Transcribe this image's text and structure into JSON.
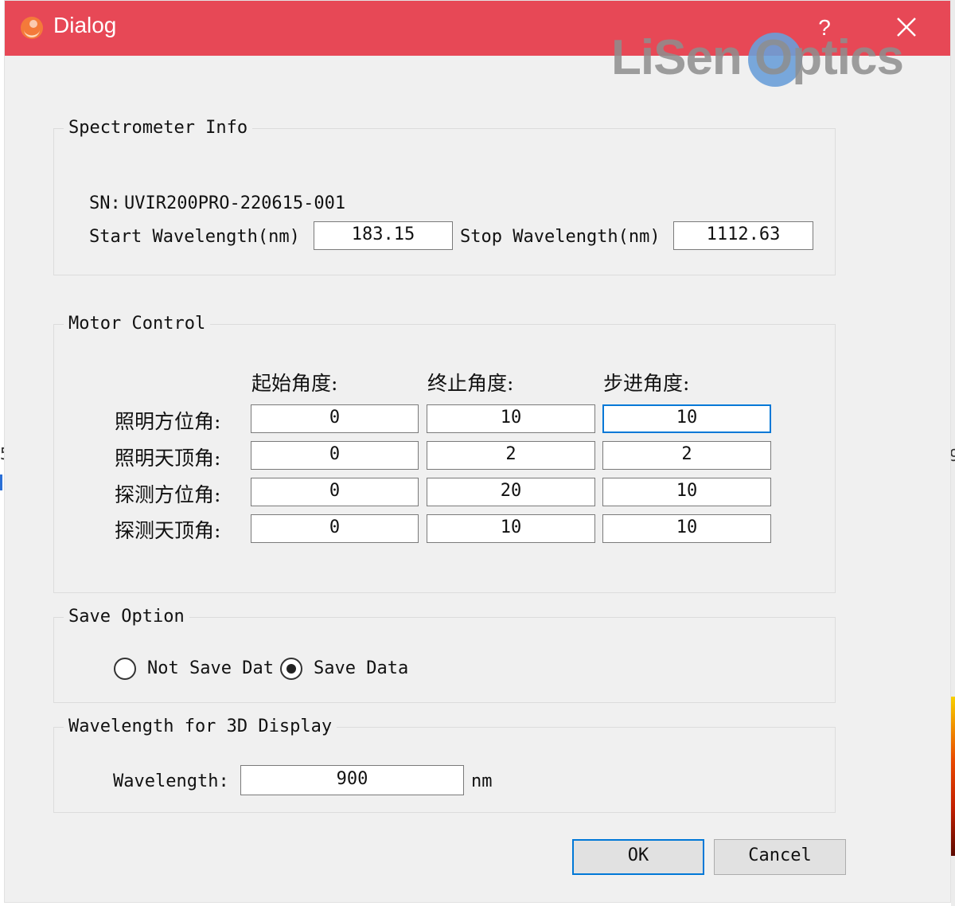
{
  "window": {
    "title": "Dialog",
    "help_label": "?",
    "icon": "app-logo-icon",
    "close_icon": "close-icon",
    "accent_color": "#e74856",
    "watermark": "LiSen Optics"
  },
  "background": {
    "left_mark": "5",
    "right_mark": "9"
  },
  "spectrometer": {
    "title": "Spectrometer Info",
    "sn_label": "SN:",
    "sn_value": "UVIR200PRO-220615-001",
    "start_label": "Start Wavelength(nm)",
    "start_value": "183.15",
    "stop_label": "Stop Wavelength(nm)",
    "stop_value": "1112.63"
  },
  "motor": {
    "title": "Motor Control",
    "columns": [
      "起始角度:",
      "终止角度:",
      "步进角度:"
    ],
    "rows": [
      {
        "label": "照明方位角:",
        "values": [
          "0",
          "10",
          "10"
        ]
      },
      {
        "label": "照明天顶角:",
        "values": [
          "0",
          "2",
          "2"
        ]
      },
      {
        "label": "探测方位角:",
        "values": [
          "0",
          "20",
          "10"
        ]
      },
      {
        "label": "探测天顶角:",
        "values": [
          "0",
          "10",
          "10"
        ]
      }
    ]
  },
  "save": {
    "title": "Save Option",
    "not_save_label": "Not Save Dat",
    "save_label": "Save Data",
    "selected": "Save Data"
  },
  "display3d": {
    "title": "Wavelength for 3D Display",
    "wavelength_label": "Wavelength:",
    "wavelength_value": "900",
    "unit": "nm"
  },
  "buttons": {
    "ok": "OK",
    "cancel": "Cancel"
  }
}
